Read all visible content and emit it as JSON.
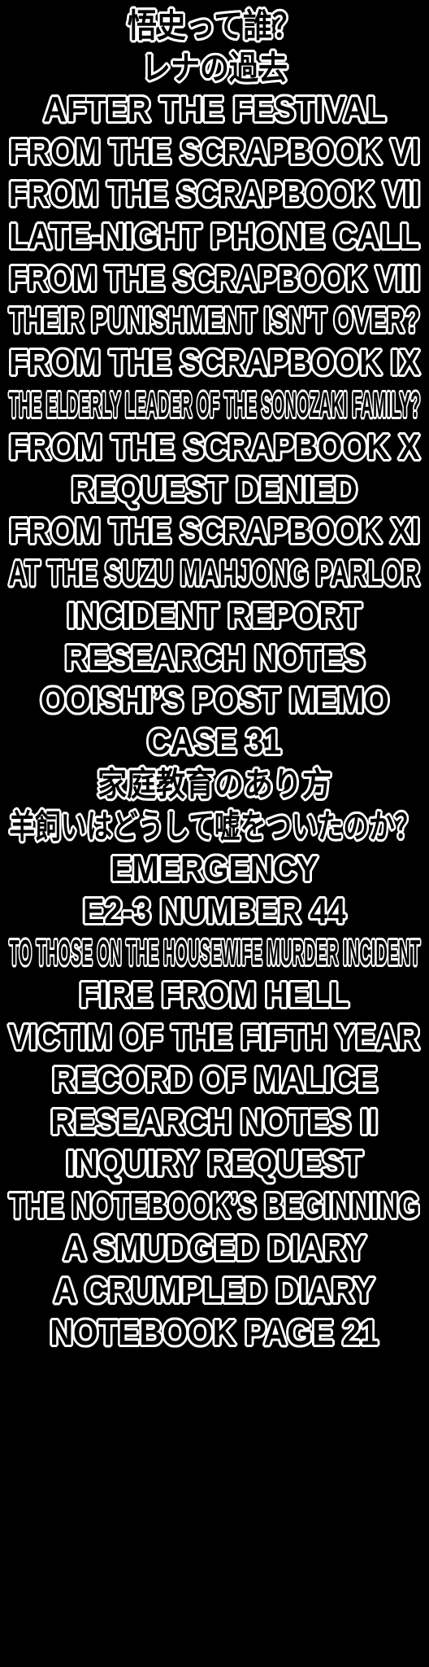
{
  "tips": [
    {
      "label": "悟史って誰？",
      "lang": "jp"
    },
    {
      "label": "レナの過去",
      "lang": "jp"
    },
    {
      "label": "AFTER THE FESTIVAL",
      "lang": "en"
    },
    {
      "label": "FROM THE SCRAPBOOK VI",
      "lang": "en"
    },
    {
      "label": "FROM THE SCRAPBOOK VII",
      "lang": "en"
    },
    {
      "label": "LATE-NIGHT PHONE CALL",
      "lang": "en"
    },
    {
      "label": "FROM THE SCRAPBOOK VIII",
      "lang": "en"
    },
    {
      "label": "THEIR PUNISHMENT ISN'T OVER?",
      "lang": "en"
    },
    {
      "label": "FROM THE SCRAPBOOK IX",
      "lang": "en"
    },
    {
      "label": "THE ELDERLY LEADER OF THE SONOZAKI FAMILY?",
      "lang": "en"
    },
    {
      "label": "FROM THE SCRAPBOOK X",
      "lang": "en"
    },
    {
      "label": "REQUEST DENIED",
      "lang": "en"
    },
    {
      "label": "FROM THE SCRAPBOOK XI",
      "lang": "en"
    },
    {
      "label": "AT THE SUZU MAHJONG PARLOR",
      "lang": "en"
    },
    {
      "label": "INCIDENT REPORT",
      "lang": "en"
    },
    {
      "label": "RESEARCH NOTES",
      "lang": "en"
    },
    {
      "label": "OOISHI’S POST MEMO",
      "lang": "en"
    },
    {
      "label": "CASE 31",
      "lang": "en"
    },
    {
      "label": "家庭教育のあり方",
      "lang": "jp"
    },
    {
      "label": "羊飼いはどうして嘘をついたのか？",
      "lang": "jp"
    },
    {
      "label": "EMERGENCY",
      "lang": "en"
    },
    {
      "label": "E2-3 NUMBER 44",
      "lang": "en"
    },
    {
      "label": "TO THOSE ON THE HOUSEWIFE MURDER INCIDENT",
      "lang": "en"
    },
    {
      "label": "FIRE FROM HELL",
      "lang": "en"
    },
    {
      "label": "VICTIM OF THE FIFTH YEAR",
      "lang": "en"
    },
    {
      "label": "RECORD OF MALICE",
      "lang": "en"
    },
    {
      "label": "RESEARCH NOTES II",
      "lang": "en"
    },
    {
      "label": "INQUIRY REQUEST",
      "lang": "en"
    },
    {
      "label": "THE NOTEBOOK’S BEGINNING",
      "lang": "en"
    },
    {
      "label": "A SMUDGED DIARY",
      "lang": "en"
    },
    {
      "label": "A CRUMPLED DIARY",
      "lang": "en"
    },
    {
      "label": "NOTEBOOK PAGE 21",
      "lang": "en"
    }
  ]
}
